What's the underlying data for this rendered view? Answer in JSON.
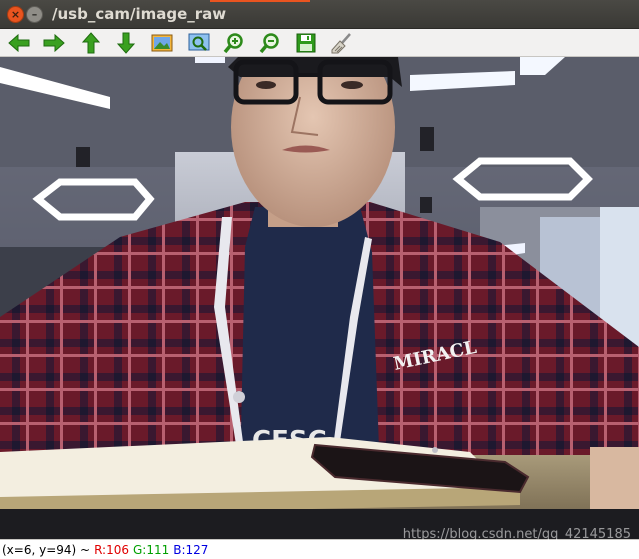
{
  "window": {
    "title": "/usb_cam/image_raw",
    "close_glyph": "×",
    "minimize_glyph": "–"
  },
  "toolbar": {
    "buttons": [
      {
        "icon": "arrow-left-icon"
      },
      {
        "icon": "arrow-right-icon"
      },
      {
        "icon": "arrow-up-icon"
      },
      {
        "icon": "arrow-down-icon"
      },
      {
        "icon": "image-icon"
      },
      {
        "icon": "zoom-fit-icon"
      },
      {
        "icon": "zoom-in-icon"
      },
      {
        "icon": "zoom-out-icon"
      },
      {
        "icon": "save-icon"
      },
      {
        "icon": "clear-brush-icon"
      }
    ]
  },
  "image": {
    "shirt_text": "MIRACL",
    "shirt_text_lower": "CESC"
  },
  "status": {
    "coords": "(x=6, y=94) ~",
    "r": "R:106",
    "g": "G:111",
    "b": "B:127"
  },
  "watermark": "https://blog.csdn.net/qq_42145185"
}
